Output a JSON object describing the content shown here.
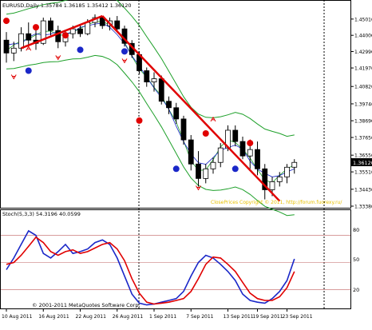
{
  "main_chart": {
    "header": "EURUSD,Daily  1.35784 1.36185 1.35412 1.36120",
    "current_price": "1.36120",
    "watermark": "ClosePrices Copyright © 2011, http://forum.fuorexy.ru/",
    "price_ticks": [
      "1.45010",
      "1.44000",
      "1.42990",
      "1.41970",
      "1.40820",
      "1.39740",
      "1.38690",
      "1.37650",
      "1.36550",
      "1.35510",
      "1.34430",
      "1.33380"
    ],
    "colors": {
      "bull_candle": "#ffffff",
      "bear_candle": "#000000",
      "trend_line": "#e00000",
      "band_line": "#1ea02a",
      "mid_line": "#1ea02a",
      "ma_line": "#1a27c8",
      "dot_red": "#e00000",
      "dot_blue": "#1a27c8",
      "marker": "#e00000"
    }
  },
  "chart_data": [
    {
      "type": "candlestick",
      "title": "EURUSD,Daily  1.35784 1.36185 1.35412 1.36120",
      "ylim": [
        1.3338,
        1.455
      ],
      "x": [
        "10 Aug 2011",
        "16 Aug 2011",
        "22 Aug 2011",
        "26 Aug 2011",
        "1 Sep 2011",
        "7 Sep 2011",
        "13 Sep 2011",
        "19 Sep 2011",
        "23 Sep 2011"
      ],
      "ohlc": [
        [
          1.437,
          1.442,
          1.423,
          1.429
        ],
        [
          1.429,
          1.436,
          1.424,
          1.432
        ],
        [
          1.432,
          1.445,
          1.43,
          1.441
        ],
        [
          1.441,
          1.448,
          1.433,
          1.437
        ],
        [
          1.437,
          1.444,
          1.431,
          1.435
        ],
        [
          1.435,
          1.451,
          1.434,
          1.449
        ],
        [
          1.449,
          1.451,
          1.44,
          1.443
        ],
        [
          1.443,
          1.446,
          1.432,
          1.436
        ],
        [
          1.436,
          1.443,
          1.433,
          1.441
        ],
        [
          1.441,
          1.446,
          1.438,
          1.444
        ],
        [
          1.444,
          1.447,
          1.439,
          1.441
        ],
        [
          1.441,
          1.45,
          1.44,
          1.448
        ],
        [
          1.448,
          1.453,
          1.445,
          1.451
        ],
        [
          1.451,
          1.452,
          1.444,
          1.446
        ],
        [
          1.446,
          1.451,
          1.443,
          1.449
        ],
        [
          1.449,
          1.452,
          1.442,
          1.444
        ],
        [
          1.444,
          1.446,
          1.433,
          1.435
        ],
        [
          1.435,
          1.437,
          1.426,
          1.428
        ],
        [
          1.428,
          1.43,
          1.416,
          1.418
        ],
        [
          1.418,
          1.42,
          1.408,
          1.411
        ],
        [
          1.411,
          1.417,
          1.405,
          1.413
        ],
        [
          1.413,
          1.415,
          1.397,
          1.399
        ],
        [
          1.399,
          1.402,
          1.391,
          1.395
        ],
        [
          1.395,
          1.398,
          1.385,
          1.388
        ],
        [
          1.388,
          1.39,
          1.372,
          1.375
        ],
        [
          1.375,
          1.378,
          1.356,
          1.36
        ],
        [
          1.36,
          1.368,
          1.346,
          1.351
        ],
        [
          1.351,
          1.36,
          1.348,
          1.357
        ],
        [
          1.357,
          1.364,
          1.354,
          1.361
        ],
        [
          1.361,
          1.373,
          1.358,
          1.37
        ],
        [
          1.37,
          1.384,
          1.368,
          1.381
        ],
        [
          1.381,
          1.384,
          1.371,
          1.374
        ],
        [
          1.374,
          1.377,
          1.363,
          1.365
        ],
        [
          1.365,
          1.371,
          1.357,
          1.369
        ],
        [
          1.369,
          1.374,
          1.353,
          1.357
        ],
        [
          1.357,
          1.36,
          1.338,
          1.344
        ],
        [
          1.344,
          1.352,
          1.34,
          1.349
        ],
        [
          1.349,
          1.355,
          1.346,
          1.352
        ],
        [
          1.352,
          1.36,
          1.348,
          1.358
        ],
        [
          1.358,
          1.363,
          1.354,
          1.361
        ]
      ],
      "trend_lines": [
        {
          "name": "up",
          "from": [
            2,
            1.432
          ],
          "to": [
            13,
            1.452
          ]
        },
        {
          "name": "down",
          "from": [
            13,
            1.452
          ],
          "to": [
            37,
            1.337
          ]
        }
      ],
      "red_dots": [
        [
          0,
          1.449
        ],
        [
          4,
          1.445
        ],
        [
          8,
          1.44
        ],
        [
          27,
          1.379
        ],
        [
          33,
          1.373
        ],
        [
          18,
          1.387
        ]
      ],
      "blue_dots": [
        [
          3,
          1.418
        ],
        [
          10,
          1.431
        ],
        [
          16,
          1.43
        ],
        [
          23,
          1.357
        ],
        [
          31,
          1.357
        ]
      ],
      "up_markers": [
        [
          28,
          1.388
        ],
        [
          33,
          1.374
        ],
        [
          3,
          1.432
        ]
      ],
      "down_markers": [
        [
          1,
          1.414
        ],
        [
          7,
          1.426
        ],
        [
          16,
          1.424
        ],
        [
          26,
          1.345
        ]
      ]
    },
    {
      "type": "line",
      "title": "Stoch(5,3,3) 54.3196 40.0599",
      "ylim": [
        0,
        100
      ],
      "levels": [
        80,
        50,
        20
      ],
      "x": [
        "10 Aug 2011",
        "16 Aug 2011",
        "22 Aug 2011",
        "26 Aug 2011",
        "1 Sep 2011",
        "7 Sep 2011",
        "13 Sep 2011",
        "19 Sep 2011",
        "23 Sep 2011"
      ],
      "series": [
        {
          "name": "main",
          "color": "#1a27c8",
          "values": [
            42,
            55,
            70,
            85,
            80,
            60,
            55,
            62,
            70,
            60,
            62,
            65,
            72,
            75,
            70,
            55,
            35,
            15,
            5,
            3,
            4,
            6,
            8,
            10,
            18,
            35,
            50,
            58,
            55,
            48,
            40,
            30,
            15,
            8,
            6,
            5,
            10,
            18,
            30,
            54
          ]
        },
        {
          "name": "signal",
          "color": "#e00000",
          "values": [
            48,
            50,
            58,
            68,
            78,
            72,
            62,
            58,
            62,
            64,
            60,
            62,
            66,
            70,
            72,
            65,
            52,
            32,
            16,
            6,
            4,
            5,
            6,
            8,
            10,
            18,
            32,
            48,
            56,
            55,
            48,
            40,
            28,
            16,
            10,
            8,
            8,
            12,
            22,
            40
          ]
        }
      ]
    }
  ],
  "stoch": {
    "header": "Stoch(5,3,3) 54.3196 40.0599",
    "levels": [
      "80",
      "50",
      "20"
    ]
  },
  "time_axis": {
    "labels": [
      "10 Aug 2011",
      "16 Aug 2011",
      "22 Aug 2011",
      "26 Aug 2011",
      "1 Sep 2011",
      "7 Sep 2011",
      "13 Sep 2011",
      "19 Sep 2011",
      "23 Sep 2011"
    ]
  },
  "copyright": "© 2001-2011 MetaQuotes Software Corp."
}
